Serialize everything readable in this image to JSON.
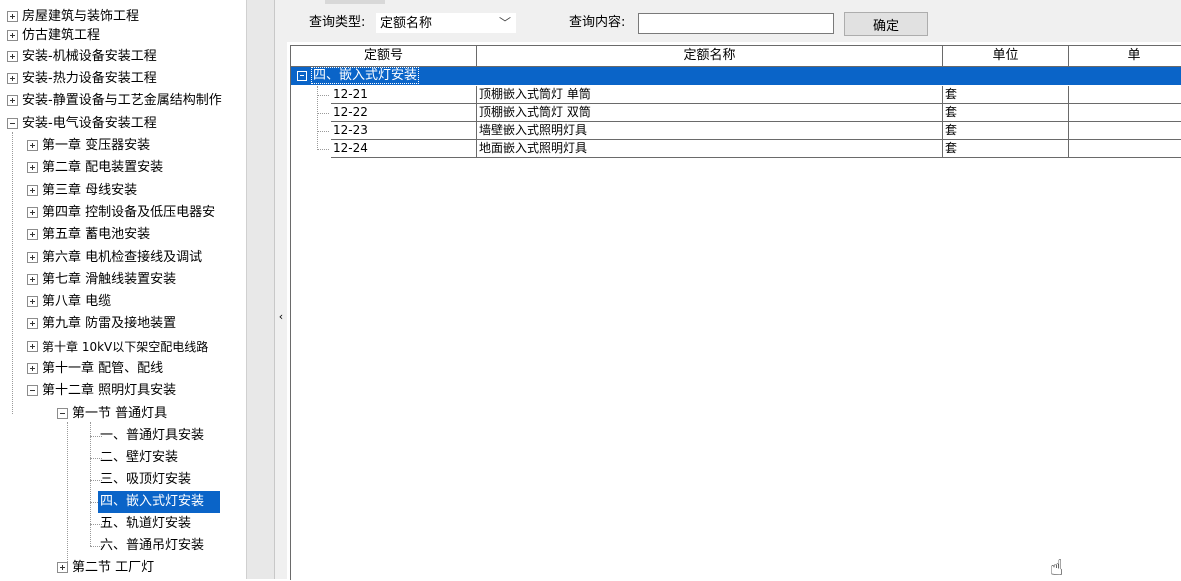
{
  "tree": {
    "nodes": [
      {
        "label": "房屋建筑与装饰工程",
        "toggle": "plus"
      },
      {
        "label": "仿古建筑工程",
        "toggle": "plus"
      },
      {
        "label": "安装-机械设备安装工程",
        "toggle": "plus"
      },
      {
        "label": "安装-热力设备安装工程",
        "toggle": "plus"
      },
      {
        "label": "安装-静置设备与工艺金属结构制作",
        "toggle": "plus"
      },
      {
        "label": "安装-电气设备安装工程",
        "toggle": "minus"
      },
      {
        "label": "第一章 变压器安装",
        "toggle": "plus"
      },
      {
        "label": "第二章 配电装置安装",
        "toggle": "plus"
      },
      {
        "label": "第三章 母线安装",
        "toggle": "plus"
      },
      {
        "label": "第四章 控制设备及低压电器安",
        "toggle": "plus"
      },
      {
        "label": "第五章 蓄电池安装",
        "toggle": "plus"
      },
      {
        "label": "第六章 电机检查接线及调试",
        "toggle": "plus"
      },
      {
        "label": "第七章 滑触线装置安装",
        "toggle": "plus"
      },
      {
        "label": "第八章 电缆",
        "toggle": "plus"
      },
      {
        "label": "第九章 防雷及接地装置",
        "toggle": "plus"
      },
      {
        "label": "第十章 10kV以下架空配电线路",
        "toggle": "plus"
      },
      {
        "label": "第十一章 配管、配线",
        "toggle": "plus"
      },
      {
        "label": "第十二章 照明灯具安装",
        "toggle": "minus"
      },
      {
        "label": "第一节 普通灯具",
        "toggle": "minus"
      },
      {
        "label": "一、普通灯具安装",
        "toggle": "none"
      },
      {
        "label": "二、壁灯安装",
        "toggle": "none"
      },
      {
        "label": "三、吸顶灯安装",
        "toggle": "none"
      },
      {
        "label": "四、嵌入式灯安装",
        "toggle": "none",
        "selected": true
      },
      {
        "label": "五、轨道灯安装",
        "toggle": "none"
      },
      {
        "label": "六、普通吊灯安装",
        "toggle": "none"
      },
      {
        "label": "第二节 工厂灯",
        "toggle": "plus"
      }
    ]
  },
  "query": {
    "type_label": "查询类型:",
    "type_value": "定额名称",
    "content_label": "查询内容:",
    "content_value": "",
    "confirm_label": "确定"
  },
  "grid": {
    "columns": [
      "定额号",
      "定额名称",
      "单位",
      "单"
    ],
    "group_label": "四、嵌入式灯安装",
    "rows": [
      {
        "code": "12-21",
        "name": "顶棚嵌入式筒灯 单筒",
        "unit": "套"
      },
      {
        "code": "12-22",
        "name": "顶棚嵌入式筒灯 双筒",
        "unit": "套"
      },
      {
        "code": "12-23",
        "name": "墙壁嵌入式照明灯具",
        "unit": "套"
      },
      {
        "code": "12-24",
        "name": "地面嵌入式照明灯具",
        "unit": "套"
      }
    ]
  },
  "colors": {
    "selection": "#0a64c8",
    "panel": "#f0f0f0"
  },
  "icons": {
    "splitter": "chevron-left-icon",
    "cursor": "hand-cursor-icon",
    "select": "chevron-down-icon"
  }
}
